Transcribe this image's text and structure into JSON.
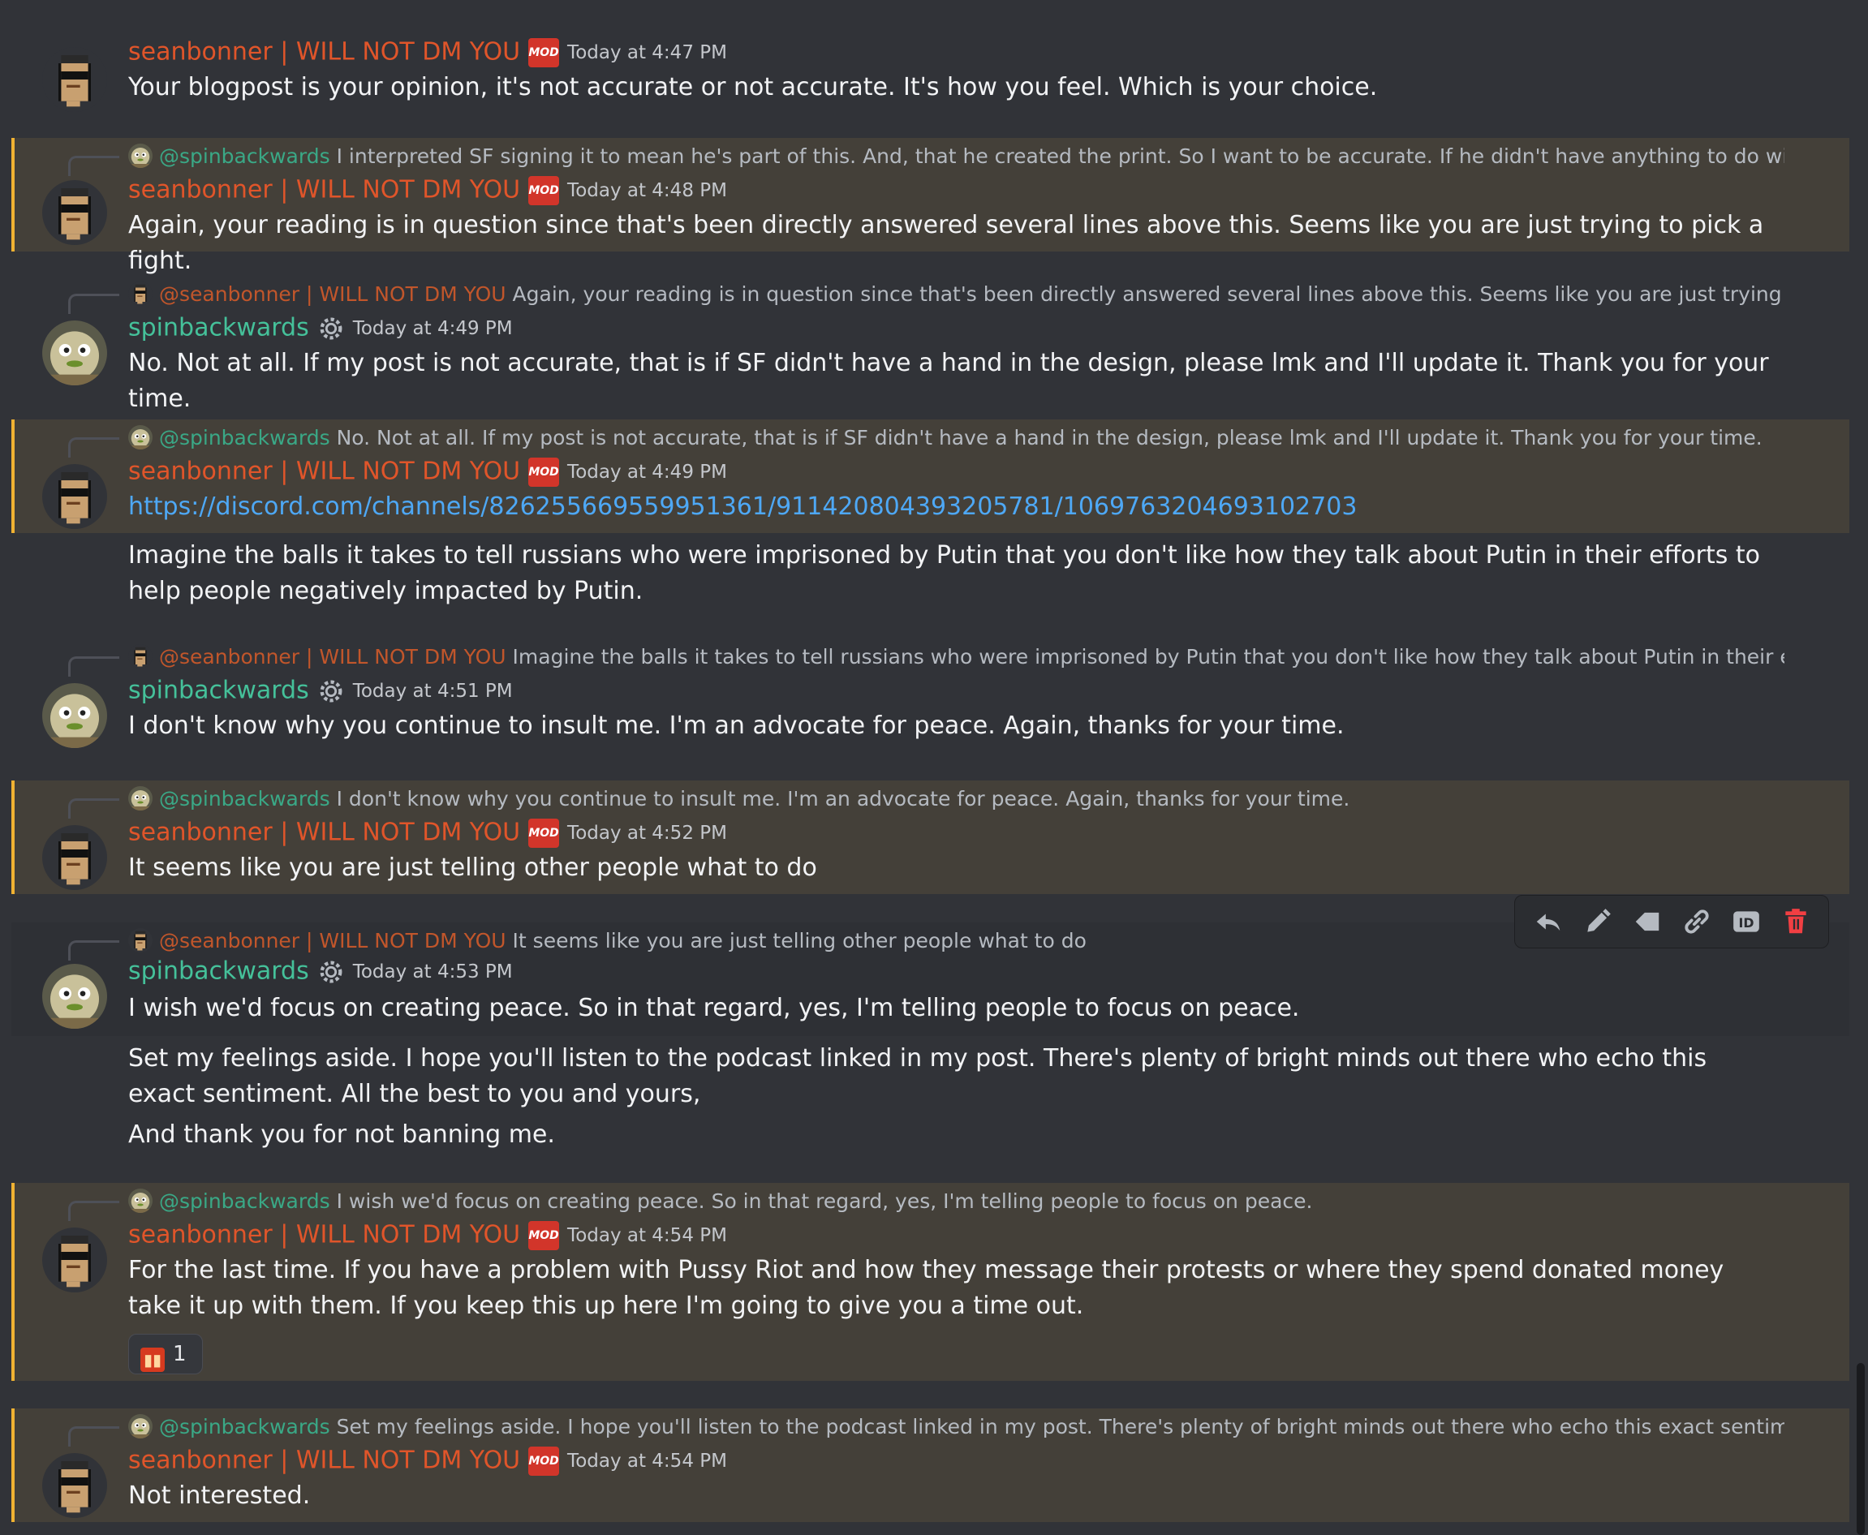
{
  "users": {
    "mod_name": "seanbonner | WILL NOT DM YOU",
    "user_name": "spinbackwards",
    "mod_badge": "MOD",
    "mention_mod": "@seanbonner | WILL NOT DM YOU",
    "mention_user": "@spinbackwards"
  },
  "messages": [
    {
      "timestamp": "Today at 4:47 PM",
      "text": "Your blogpost is your opinion, it's not accurate or not accurate. It's how you feel. Which is your choice."
    },
    {
      "reply": "I interpreted SF signing it to mean he's part of this. And, that he created the print. So I want to be accurate. If he didn't have anything to do with the de",
      "timestamp": "Today at 4:48 PM",
      "text": "Again, your reading is in question since that's been directly answered several lines above this. Seems like you are just trying to pick a fight."
    },
    {
      "reply": "Again, your reading is in question since that's been directly answered several lines above this. Seems like you are just trying to pick a",
      "timestamp": "Today at 4:49 PM",
      "text": "No. Not at all. If my post is not accurate, that is if SF didn't have a hand in the design, please lmk and I'll update it. Thank you for your time."
    },
    {
      "reply": "No. Not at all. If my post is not accurate, that is if SF didn't have a hand in the design, please lmk and I'll update it. Thank you for your time.",
      "timestamp": "Today at 4:49 PM",
      "link": "https://discord.com/channels/826255669559951361/911420804393205781/1069763204693102703",
      "text": "Imagine the balls it takes to tell russians who were imprisoned by Putin that you don't like how they talk about Putin in their efforts to help people negatively impacted by Putin."
    },
    {
      "reply": "Imagine the balls it takes to tell russians who were imprisoned by Putin that you don't like how they talk about Putin in their efforts t",
      "timestamp": "Today at 4:51 PM",
      "text": "I don't know why you continue to insult me. I'm an advocate for peace. Again, thanks for your time."
    },
    {
      "reply": "I don't know why you continue to insult me. I'm an advocate for peace. Again, thanks for your time.",
      "timestamp": "Today at 4:52 PM",
      "text": "It seems like you are just telling other people what to do"
    },
    {
      "reply": "It seems like you are just telling other people what to do",
      "timestamp": "Today at 4:53 PM",
      "text": "I wish we'd focus on creating peace. So in that regard, yes, I'm telling people to focus on peace.",
      "text2": "Set my feelings aside. I hope you'll listen to the podcast linked in my post. There's plenty of bright minds out there who echo this exact sentiment. All the best to you and yours,",
      "text3": "And thank you for not banning me."
    },
    {
      "reply": "I wish we'd focus on creating peace. So in that regard, yes, I'm telling people to focus on peace.",
      "timestamp": "Today at 4:54 PM",
      "text": "For the last time. If you have a problem with Pussy Riot and how they message their protests or where they spend donated money take it up with them. If you keep this up here I'm going to give you a time out.",
      "reaction_count": "1"
    },
    {
      "reply": "Set my feelings aside. I hope you'll listen to the podcast linked in my post. There's plenty of bright minds out there who echo this exact sentiment. All t",
      "timestamp": "Today at 4:54 PM",
      "text": "Not interested."
    }
  ],
  "toolbar": {
    "icons": [
      "reply-icon",
      "edit-icon",
      "tag-icon",
      "link-icon",
      "id-icon",
      "delete-icon"
    ],
    "id_label": "ID"
  },
  "colors": {
    "mod": "#e0552a",
    "user": "#45c19a",
    "highlight": "#444039",
    "accent": "#f0b232",
    "link": "#4ea8f5"
  }
}
